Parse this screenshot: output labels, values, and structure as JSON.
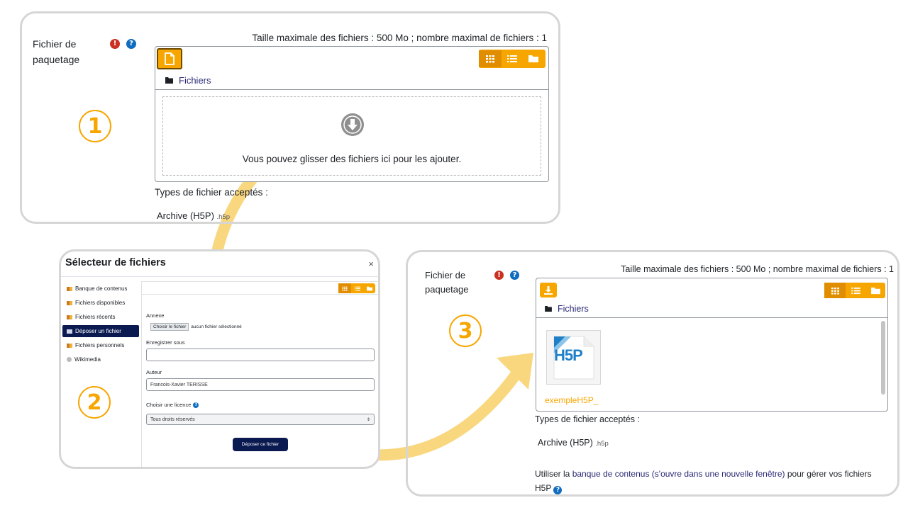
{
  "panel1": {
    "field_label": "Fichier de paquetage",
    "max_info": "Taille maximale des fichiers : 500 Mo ; nombre maximal de fichiers : 1",
    "folder_label": "Fichiers",
    "drop_text": "Vous pouvez glisser des fichiers ici pour les ajouter.",
    "types_title": "Types de fichier acceptés :",
    "type_name": "Archive (H5P)",
    "type_ext": ".h5p",
    "step_number": "1"
  },
  "modal": {
    "title": "Sélecteur de fichiers",
    "close_label": "×",
    "sidebar": [
      {
        "label": "Banque de contenus",
        "icon": "repository-icon"
      },
      {
        "label": "Fichiers disponibles",
        "icon": "repository-icon"
      },
      {
        "label": "Fichiers récents",
        "icon": "repository-icon"
      },
      {
        "label": "Déposer un fichier",
        "icon": "upload-repository-icon"
      },
      {
        "label": "Fichiers personnels",
        "icon": "repository-icon"
      },
      {
        "label": "Wikimedia",
        "icon": "wikimedia-icon"
      }
    ],
    "annex_label": "Annexe",
    "choose_button": "Choisir le fichier",
    "no_file_text": "aucun fichier sélectionné",
    "save_as_label": "Enregistrer sous",
    "save_as_value": "",
    "author_label": "Auteur",
    "author_value": "Francois-Xavier TERISSE",
    "license_label": "Choisir une licence",
    "license_value": "Tous droits réservés",
    "submit_button": "Déposer ce fichier",
    "step_number": "2"
  },
  "panel3": {
    "field_label": "Fichier de paquetage",
    "max_info": "Taille maximale des fichiers : 500 Mo ; nombre maximal de fichiers : 1",
    "folder_label": "Fichiers",
    "file_name": "exempleH5P_",
    "tile_logo_text": "H5P",
    "types_title": "Types de fichier acceptés :",
    "type_name": "Archive (H5P)",
    "type_ext": ".h5p",
    "note_prefix": "Utiliser la ",
    "note_link": "banque de contenus (s'ouvre dans une nouvelle fenêtre)",
    "note_suffix": " pour gérer vos fichiers H5P",
    "step_number": "3"
  },
  "colors": {
    "accent_orange": "#f7a600",
    "arrow_yellow": "#f9d77e",
    "nav_dark": "#0b1951",
    "link": "#2a2a75",
    "required_red": "#ca3120",
    "help_blue": "#0f6cbf"
  }
}
